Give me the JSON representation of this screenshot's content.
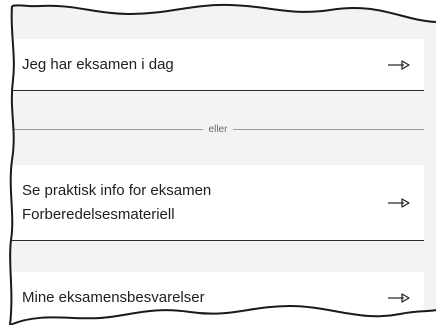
{
  "cards": [
    {
      "lines": [
        "Jeg har eksamen i dag"
      ]
    },
    {
      "lines": [
        "Se praktisk info for eksamen",
        "Forberedelsesmateriell"
      ]
    },
    {
      "lines": [
        "Mine eksamensbesvarelser"
      ]
    }
  ],
  "divider": {
    "label": "eller"
  },
  "icons": {
    "arrow": "arrow-right-icon"
  },
  "colors": {
    "page_bg": "#f3f3f3",
    "card_bg": "#ffffff",
    "text": "#1f1f1f",
    "divider_line": "#9a9a9a"
  }
}
